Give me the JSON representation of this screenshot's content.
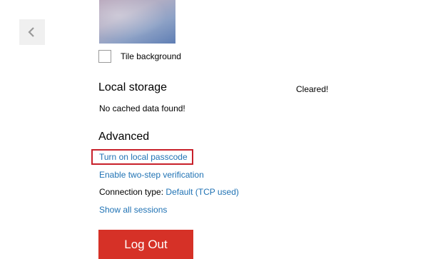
{
  "navigation": {
    "back_icon": "chevron-left-icon"
  },
  "background": {
    "tile_checked": false,
    "tile_label": "Tile background"
  },
  "local_storage": {
    "title": "Local storage",
    "status": "Cleared!",
    "message": "No cached data found!"
  },
  "advanced": {
    "title": "Advanced",
    "passcode_link": "Turn on local passcode",
    "two_step_link": "Enable two-step verification",
    "connection_label": "Connection type:",
    "connection_value": "Default (TCP used)",
    "sessions_link": "Show all sessions"
  },
  "logout": {
    "label": "Log Out"
  },
  "colors": {
    "link": "#1f72b4",
    "highlight": "#c8202a",
    "logout_bg": "#d63127"
  }
}
